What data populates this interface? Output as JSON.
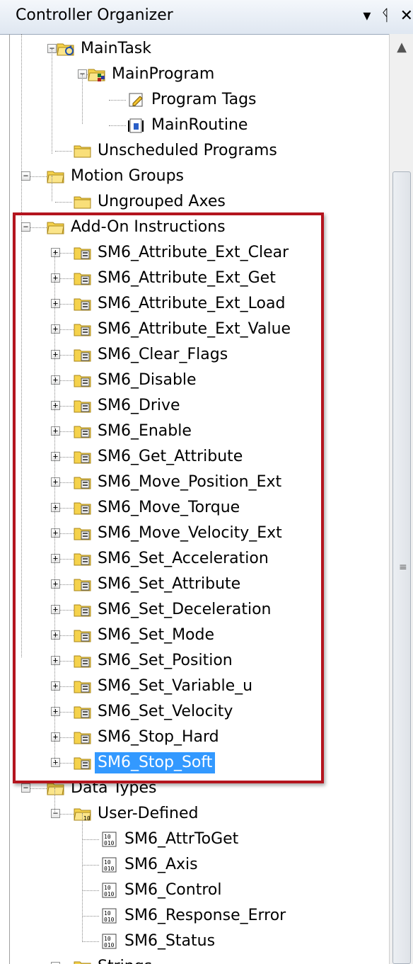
{
  "panel": {
    "title": "Controller Organizer",
    "controls": {
      "dropdown": "▾",
      "pin": "ᛩ",
      "close": "✕"
    }
  },
  "tree": {
    "rows": [
      {
        "label": "MainTask",
        "icon": "task-icon"
      },
      {
        "label": "MainProgram",
        "icon": "program-icon"
      },
      {
        "label": "Program Tags",
        "icon": "tags-icon"
      },
      {
        "label": "MainRoutine",
        "icon": "routine-icon"
      },
      {
        "label": "Unscheduled Programs",
        "icon": "folder-icon"
      },
      {
        "label": "Motion Groups",
        "icon": "folder-open-icon"
      },
      {
        "label": "Ungrouped Axes",
        "icon": "folder-icon"
      },
      {
        "label": "Add-On Instructions",
        "icon": "folder-open-icon"
      },
      {
        "label": "SM6_Attribute_Ext_Clear",
        "icon": "aoi-icon"
      },
      {
        "label": "SM6_Attribute_Ext_Get",
        "icon": "aoi-icon"
      },
      {
        "label": "SM6_Attribute_Ext_Load",
        "icon": "aoi-icon"
      },
      {
        "label": "SM6_Attribute_Ext_Value",
        "icon": "aoi-icon"
      },
      {
        "label": "SM6_Clear_Flags",
        "icon": "aoi-icon"
      },
      {
        "label": "SM6_Disable",
        "icon": "aoi-icon"
      },
      {
        "label": "SM6_Drive",
        "icon": "aoi-icon"
      },
      {
        "label": "SM6_Enable",
        "icon": "aoi-icon"
      },
      {
        "label": "SM6_Get_Attribute",
        "icon": "aoi-icon"
      },
      {
        "label": "SM6_Move_Position_Ext",
        "icon": "aoi-icon"
      },
      {
        "label": "SM6_Move_Torque",
        "icon": "aoi-icon"
      },
      {
        "label": "SM6_Move_Velocity_Ext",
        "icon": "aoi-icon"
      },
      {
        "label": "SM6_Set_Acceleration",
        "icon": "aoi-icon"
      },
      {
        "label": "SM6_Set_Attribute",
        "icon": "aoi-icon"
      },
      {
        "label": "SM6_Set_Deceleration",
        "icon": "aoi-icon"
      },
      {
        "label": "SM6_Set_Mode",
        "icon": "aoi-icon"
      },
      {
        "label": "SM6_Set_Position",
        "icon": "aoi-icon"
      },
      {
        "label": "SM6_Set_Variable_u",
        "icon": "aoi-icon"
      },
      {
        "label": "SM6_Set_Velocity",
        "icon": "aoi-icon"
      },
      {
        "label": "SM6_Stop_Hard",
        "icon": "aoi-icon"
      },
      {
        "label": "SM6_Stop_Soft",
        "icon": "aoi-icon",
        "selected": true
      },
      {
        "label": "Data Types",
        "icon": "folder-open-icon"
      },
      {
        "label": "User-Defined",
        "icon": "udt-folder-icon"
      },
      {
        "label": "SM6_AttrToGet",
        "icon": "datatype-icon"
      },
      {
        "label": "SM6_Axis",
        "icon": "datatype-icon"
      },
      {
        "label": "SM6_Control",
        "icon": "datatype-icon"
      },
      {
        "label": "SM6_Response_Error",
        "icon": "datatype-icon"
      },
      {
        "label": "SM6_Status",
        "icon": "datatype-icon"
      },
      {
        "label": "Strings",
        "icon": "folder-open-icon"
      }
    ]
  },
  "colors": {
    "selection": "#3399ff",
    "highlight_border": "#b4141e",
    "folder": "#f5d24c"
  }
}
